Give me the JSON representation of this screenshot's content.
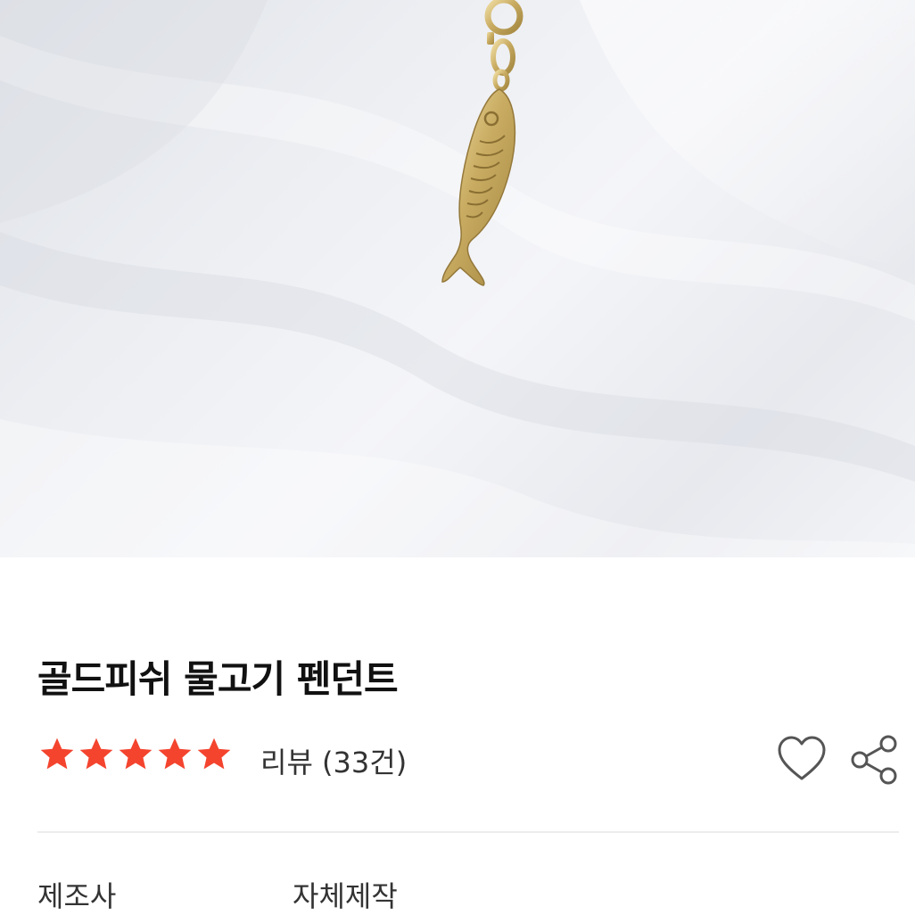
{
  "product": {
    "name": "골드피쉬 물고기 펜던트",
    "rating": {
      "stars": 5,
      "max": 5,
      "color": "#f4442e"
    },
    "review_label": "리뷰 (33건)"
  },
  "actions": {
    "like_icon": "heart-outline-icon",
    "share_icon": "share-icon"
  },
  "specs": [
    {
      "label": "제조사",
      "value": "자체제작"
    }
  ],
  "image": {
    "subject": "gold-fish-pendant-photo"
  }
}
